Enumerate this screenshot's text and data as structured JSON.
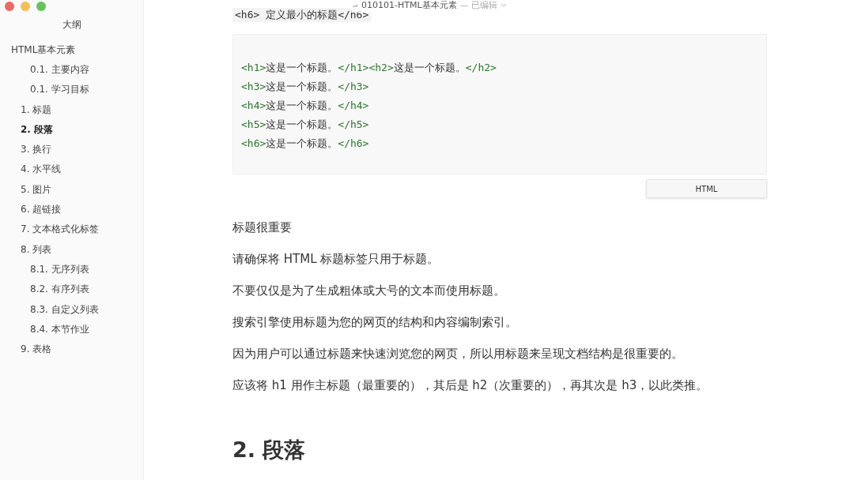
{
  "window": {
    "title": "010101-HTML基本元素",
    "status": "— 已编辑"
  },
  "sidebar": {
    "title": "大纲",
    "items": [
      {
        "label": "HTML基本元素",
        "selected": false,
        "children": [
          {
            "label": "0.1. 主要内容",
            "kind": "h3",
            "selected": false
          },
          {
            "label": "0.1. 学习目标",
            "kind": "h3",
            "selected": false
          },
          {
            "label": "1. 标题",
            "kind": "h2",
            "selected": false
          },
          {
            "label": "2. 段落",
            "kind": "h2",
            "selected": true
          },
          {
            "label": "3. 换行",
            "kind": "h2",
            "selected": false
          },
          {
            "label": "4. 水平线",
            "kind": "h2",
            "selected": false
          },
          {
            "label": "5. 图片",
            "kind": "h2",
            "selected": false
          },
          {
            "label": "6. 超链接",
            "kind": "h2",
            "selected": false
          },
          {
            "label": "7. 文本格式化标签",
            "kind": "h2",
            "selected": false
          },
          {
            "label": "8. 列表",
            "kind": "h2",
            "selected": false,
            "children": [
              {
                "label": "8.1. 无序列表",
                "kind": "h3",
                "selected": false
              },
              {
                "label": "8.2. 有序列表",
                "kind": "h3",
                "selected": false
              },
              {
                "label": "8.3. 自定义列表",
                "kind": "h3",
                "selected": false
              },
              {
                "label": "8.4. 本节作业",
                "kind": "h3",
                "selected": false
              }
            ]
          },
          {
            "label": "9. 表格",
            "kind": "h2",
            "selected": false
          }
        ]
      }
    ]
  },
  "document": {
    "inline_code": "<h6> 定义最小的标题</h6>",
    "code_block": {
      "language": "HTML",
      "lines": [
        [
          {
            "kind": "tag",
            "text": "<h1>"
          },
          {
            "kind": "text",
            "text": "这是一个标题。"
          },
          {
            "kind": "tag",
            "text": "</h1>"
          },
          {
            "kind": "tag",
            "text": "<h2>"
          },
          {
            "kind": "text",
            "text": "这是一个标题。"
          },
          {
            "kind": "tag",
            "text": "</h2>"
          }
        ],
        [
          {
            "kind": "tag",
            "text": "<h3>"
          },
          {
            "kind": "text",
            "text": "这是一个标题。"
          },
          {
            "kind": "tag",
            "text": "</h3>"
          }
        ],
        [
          {
            "kind": "tag",
            "text": "<h4>"
          },
          {
            "kind": "text",
            "text": "这是一个标题。"
          },
          {
            "kind": "tag",
            "text": "</h4>"
          }
        ],
        [
          {
            "kind": "tag",
            "text": "<h5>"
          },
          {
            "kind": "text",
            "text": "这是一个标题。"
          },
          {
            "kind": "tag",
            "text": "</h5>"
          }
        ],
        [
          {
            "kind": "tag",
            "text": "<h6>"
          },
          {
            "kind": "text",
            "text": "这是一个标题。"
          },
          {
            "kind": "tag",
            "text": "</h6>"
          }
        ]
      ]
    },
    "paragraphs": [
      "标题很重要",
      "请确保将 HTML 标题标签只用于标题。",
      "不要仅仅是为了生成粗体或大号的文本而使用标题。",
      "搜索引擎使用标题为您的网页的结构和内容编制索引。",
      "因为用户可以通过标题来快速浏览您的网页，所以用标题来呈现文档结构是很重要的。",
      "应该将 h1 用作主标题（最重要的），其后是 h2（次重要的），再其次是 h3，以此类推。"
    ],
    "heading": "2. 段落"
  }
}
